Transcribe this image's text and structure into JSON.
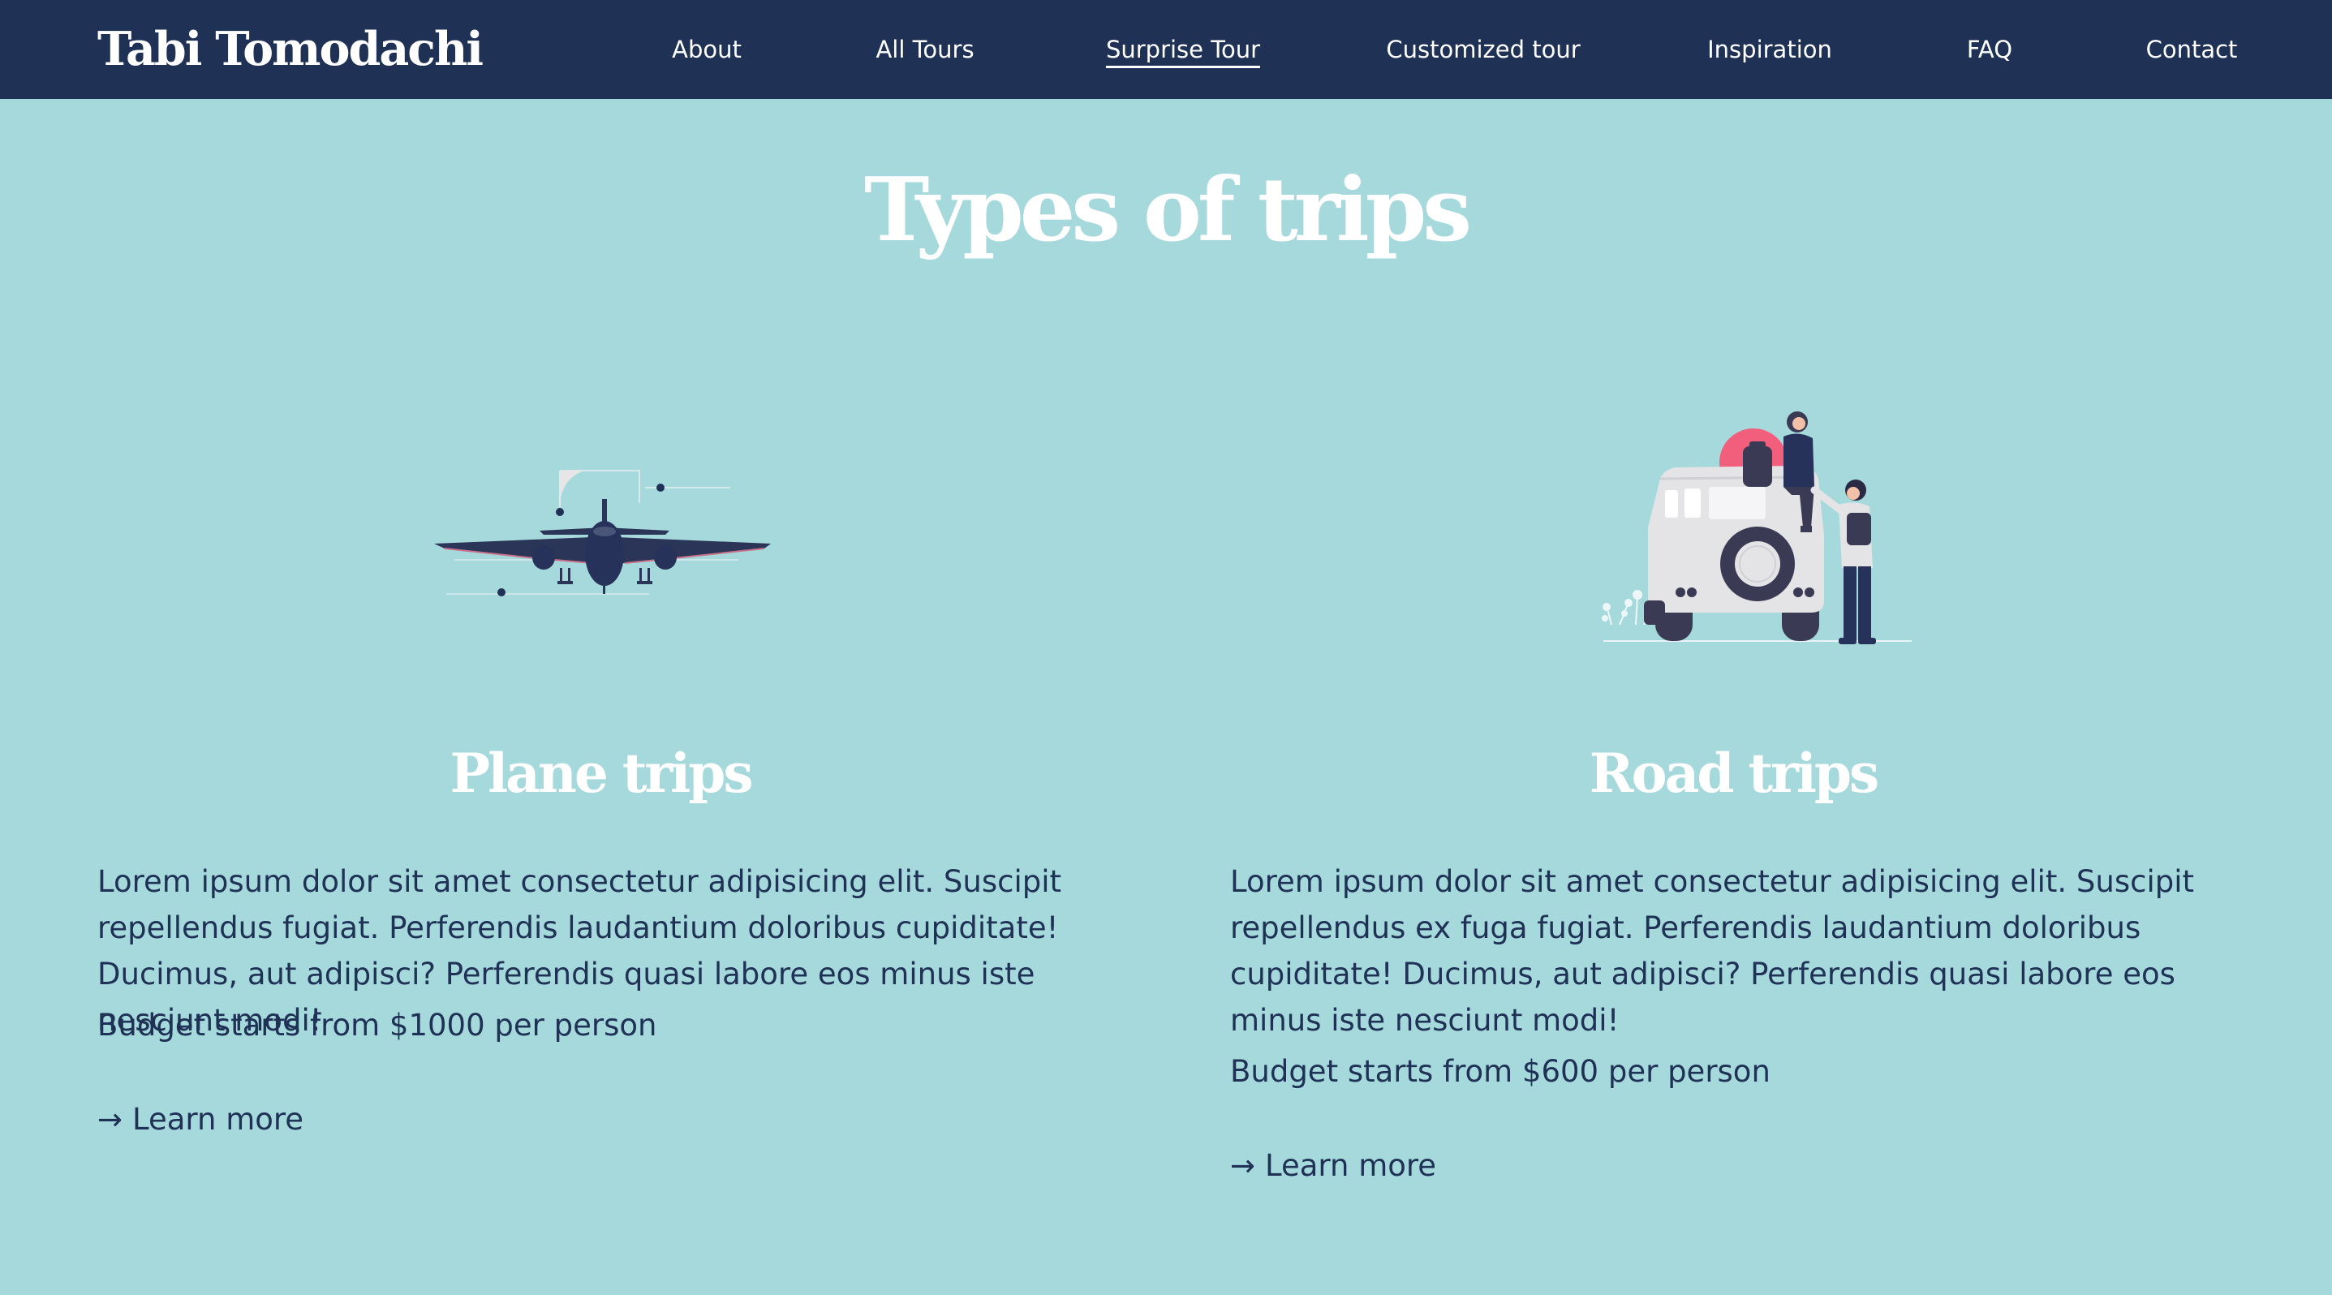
{
  "header": {
    "brand": "Tabi Tomodachi",
    "nav": [
      {
        "label": "About",
        "active": false
      },
      {
        "label": "All Tours",
        "active": false
      },
      {
        "label": "Surprise Tour",
        "active": true
      },
      {
        "label": "Customized tour",
        "active": false
      },
      {
        "label": "Inspiration",
        "active": false
      },
      {
        "label": "FAQ",
        "active": false
      },
      {
        "label": "Contact",
        "active": false
      }
    ]
  },
  "main": {
    "title": "Types of trips",
    "cards": [
      {
        "icon": "airplane-illustration",
        "title": "Plane trips",
        "description": "Lorem ipsum dolor sit amet consectetur adipisicing elit. Suscipit repellendus fugiat. Perferendis laudantium doloribus cupiditate! Ducimus, aut adipisci? Perferendis quasi labore eos minus iste nesciunt modi!",
        "budget": "Budget starts from $1000 per person",
        "link_arrow": "→",
        "link_label": "Learn more"
      },
      {
        "icon": "road-trip-illustration",
        "title": "Road trips",
        "description": "Lorem ipsum dolor sit amet consectetur adipisicing elit. Suscipit repellendus ex fuga fugiat. Perferendis laudantium doloribus cupiditate! Ducimus, aut adipisci? Perferendis quasi labore eos minus iste nesciunt modi!",
        "budget": "Budget starts from $600 per person",
        "link_arrow": "→",
        "link_label": "Learn more"
      }
    ]
  },
  "colors": {
    "background": "#a6d9dc",
    "navbar": "#1f3256",
    "text_dark": "#1f3256",
    "heading": "#ffffff",
    "accent_sun": "#f25f7d"
  }
}
